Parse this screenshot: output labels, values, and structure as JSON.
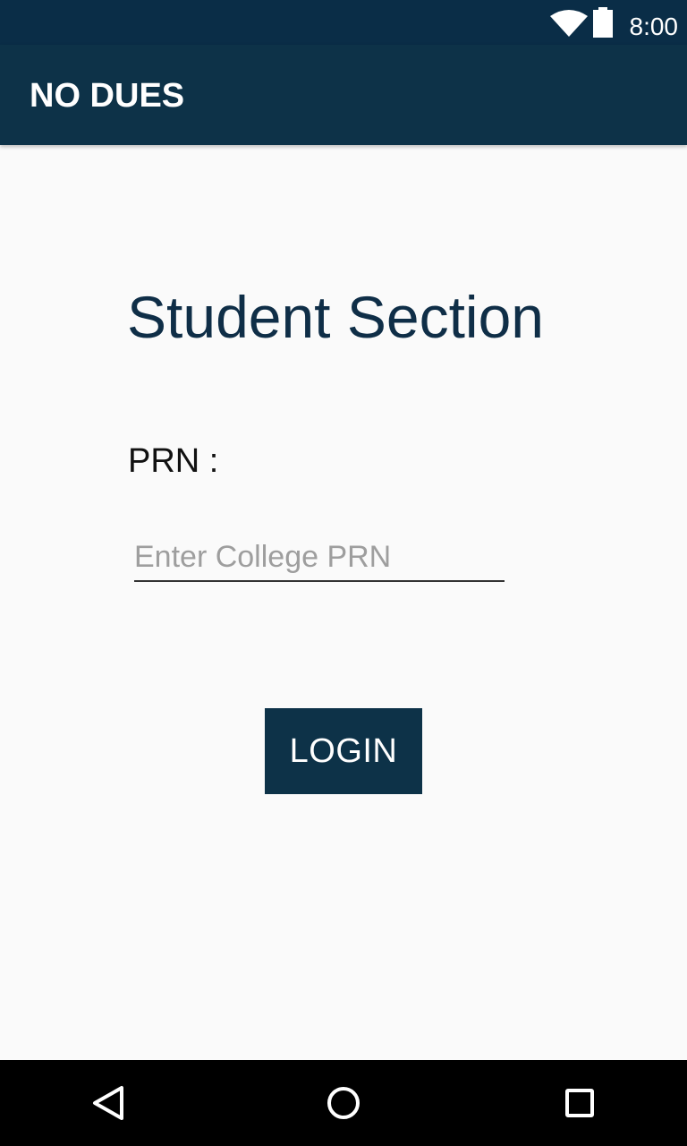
{
  "status_bar": {
    "time": "8:00",
    "icons": [
      "wifi-icon",
      "battery-icon"
    ]
  },
  "app_bar": {
    "title": "NO DUES"
  },
  "main": {
    "heading": "Student Section",
    "prn_label": "PRN :",
    "prn_input": {
      "value": "",
      "placeholder": "Enter College PRN"
    },
    "login_label": "LOGIN"
  },
  "nav_bar": {
    "buttons": [
      "back-icon",
      "home-icon",
      "recents-icon"
    ]
  },
  "colors": {
    "status_bar": "#0A2D47",
    "app_bar": "#0D3248",
    "heading": "#0F2E47",
    "button": "#0D3248",
    "background": "#FAFAFA"
  }
}
